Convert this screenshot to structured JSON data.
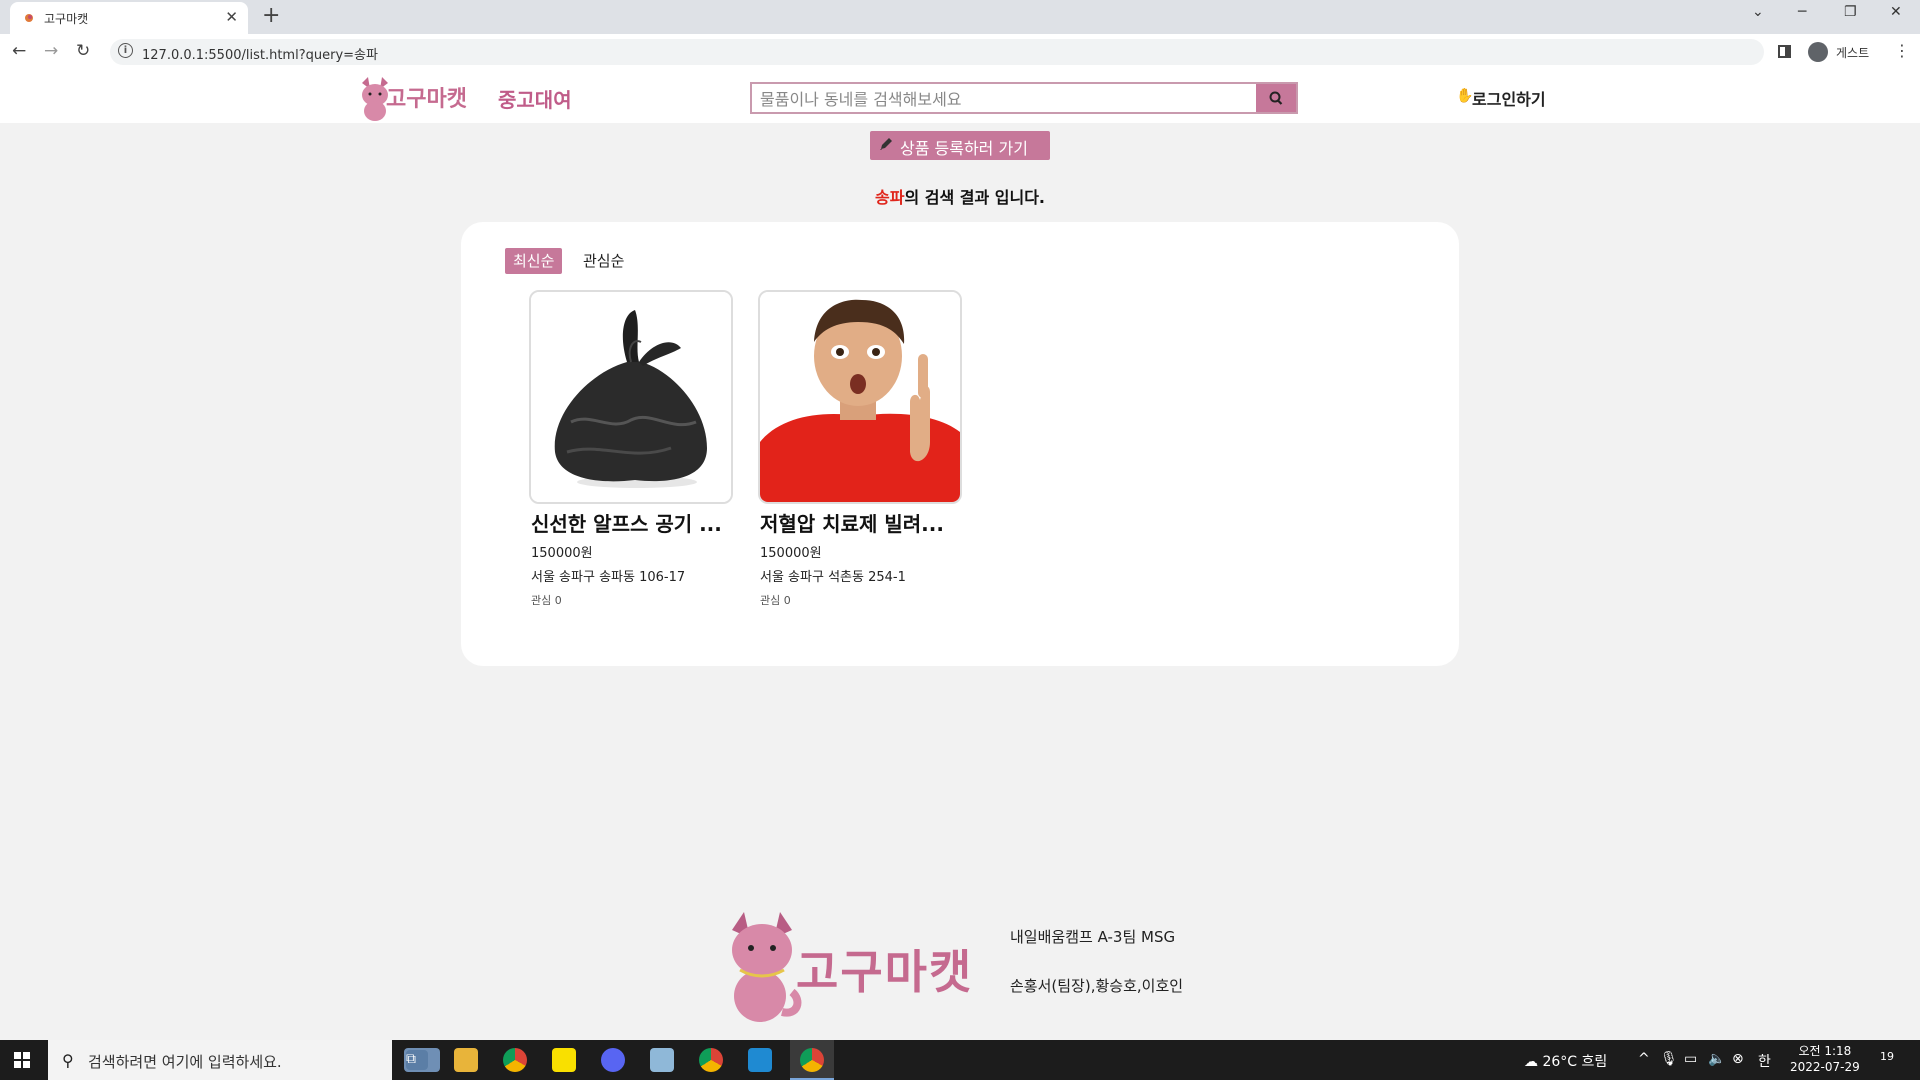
{
  "browser": {
    "tab_title": "고구마캣",
    "url": "127.0.0.1:5500/list.html?query=송파",
    "profile_name": "게스트"
  },
  "header": {
    "logo_text": "고구마캣",
    "nav_rent": "중고대여",
    "search_placeholder": "물품이나 동네를 검색해보세요",
    "login_label": "로그인하기"
  },
  "main": {
    "register_label": "상품 등록하러 가기",
    "query": "송파",
    "result_suffix": "의 검색 결과 입니다.",
    "sort_tabs": [
      "최신순",
      "관심순"
    ],
    "products": [
      {
        "title": "신선한 알프스 공기 ...",
        "price": "150000원",
        "address": "서울 송파구 송파동 106-17",
        "likes": "관심 0",
        "image": "black-garbage-bag"
      },
      {
        "title": "저혈압 치료제 빌려...",
        "price": "150000원",
        "address": "서울 송파구 석촌동 254-1",
        "likes": "관심 0",
        "image": "surprised-boy-red-shirt"
      }
    ]
  },
  "footer": {
    "logo_text": "고구마캣",
    "team": "내일배움캠프 A-3팀 MSG",
    "members": "손홍서(팀장),황승호,이호인"
  },
  "taskbar": {
    "search_placeholder": "검색하려면 여기에 입력하세요.",
    "weather": "26°C 흐림",
    "time": "오전 1:18",
    "date": "2022-07-29",
    "notifications": "19"
  },
  "colors": {
    "brand_pink": "#c6789a",
    "query_red": "#e0261c"
  }
}
